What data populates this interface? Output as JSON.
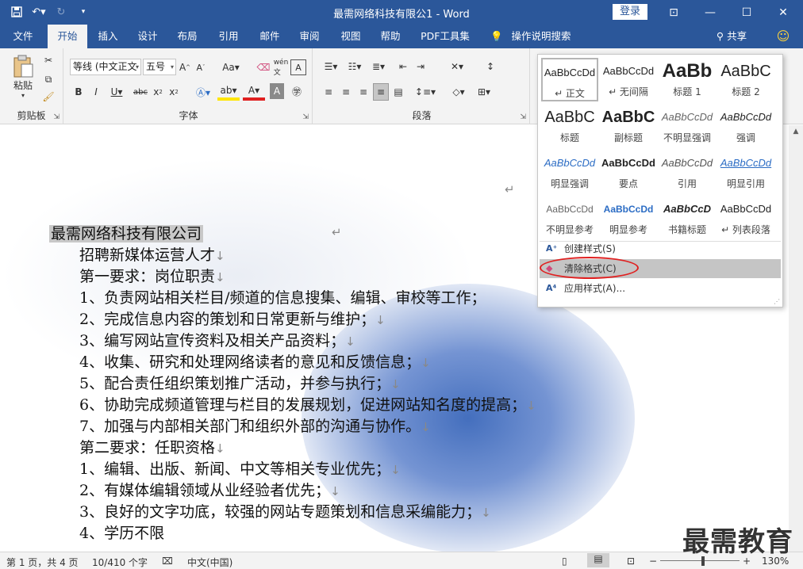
{
  "window": {
    "title": "最需网络科技有限公1  -  Word",
    "login": "登录",
    "minimize": "—",
    "restore": "☐",
    "close": "✕",
    "ribbon_display": "⊡"
  },
  "tabs": [
    "文件",
    "开始",
    "插入",
    "设计",
    "布局",
    "引用",
    "邮件",
    "审阅",
    "视图",
    "帮助",
    "PDF工具集"
  ],
  "active_tab": "开始",
  "tell_me": "操作说明搜索",
  "share": "共享",
  "ribbon": {
    "clipboard": {
      "label": "剪贴板",
      "paste": "粘贴"
    },
    "font": {
      "label": "字体",
      "name": "等线 (中文正文",
      "size": "五号"
    },
    "paragraph": {
      "label": "段落"
    }
  },
  "document": {
    "heading": "最需网络科技有限公司",
    "lines": [
      "招聘新媒体运营人才",
      "第一要求：岗位职责",
      "1、负责网站相关栏目/频道的信息搜集、编辑、审校等工作；",
      "2、完成信息内容的策划和日常更新与维护；",
      "3、编写网站宣传资料及相关产品资料；",
      "4、收集、研究和处理网络读者的意见和反馈信息；",
      "5、配合责任组织策划推广活动，并参与执行；",
      "6、协助完成频道管理与栏目的发展规划，促进网站知名度的提高；",
      "7、加强与内部相关部门和组织外部的沟通与协作。",
      "第二要求：任职资格",
      "1、编辑、出版、新闻、中文等相关专业优先；",
      "2、有媒体编辑领域从业经验者优先；",
      "3、良好的文字功底，较强的网站专题策划和信息采编能力；",
      "4、学历不限"
    ]
  },
  "styles_gallery": {
    "items": [
      {
        "preview": "AaBbCcDd",
        "name": "↵ 正文"
      },
      {
        "preview": "AaBbCcDd",
        "name": "↵ 无间隔"
      },
      {
        "preview": "AaBb",
        "name": "标题 1"
      },
      {
        "preview": "AaBbC",
        "name": "标题 2"
      },
      {
        "preview": "AaBbC",
        "name": "标题"
      },
      {
        "preview": "AaBbC",
        "name": "副标题"
      },
      {
        "preview": "AaBbCcDd",
        "name": "不明显强调"
      },
      {
        "preview": "AaBbCcDd",
        "name": "强调"
      },
      {
        "preview": "AaBbCcDd",
        "name": "明显强调"
      },
      {
        "preview": "AaBbCcDd",
        "name": "要点"
      },
      {
        "preview": "AaBbCcDd",
        "name": "引用"
      },
      {
        "preview": "AaBbCcDd",
        "name": "明显引用"
      },
      {
        "preview": "AaBbCcDd",
        "name": "不明显参考"
      },
      {
        "preview": "AaBbCcDd",
        "name": "明显参考"
      },
      {
        "preview": "AaBbCcD",
        "name": "书籍标题"
      },
      {
        "preview": "AaBbCcDd",
        "name": "↵ 列表段落"
      }
    ],
    "menu": [
      "创建样式(S)",
      "清除格式(C)",
      "应用样式(A)..."
    ]
  },
  "status": {
    "page": "第 1 页，共 4 页",
    "words": "10/410 个字",
    "language": "中文(中国)",
    "zoom": "130%"
  },
  "watermark": "最需教育",
  "colors": {
    "brand": "#2b579a",
    "highlight_circle": "#e02020"
  }
}
